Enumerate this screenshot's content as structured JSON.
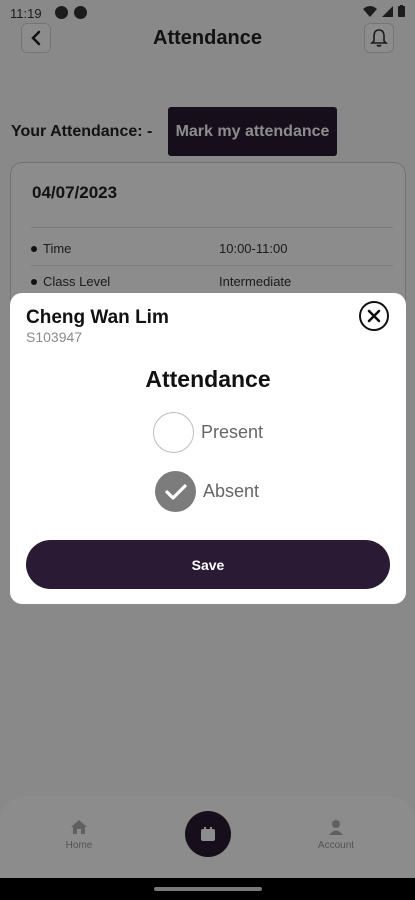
{
  "status_bar": {
    "time": "11:19"
  },
  "header": {
    "title": "Attendance"
  },
  "your_attendance": {
    "label": "Your Attendance: -",
    "button_label": "Mark my attendance"
  },
  "class_card": {
    "date": "04/07/2023",
    "rows": [
      {
        "label": "Time",
        "value": "10:00-11:00"
      },
      {
        "label": "Class Level",
        "value": "Intermediate"
      }
    ]
  },
  "modal": {
    "student_name": "Cheng Wan Lim",
    "student_id": "S103947",
    "title": "Attendance",
    "options": [
      {
        "label": "Present",
        "selected": false
      },
      {
        "label": "Absent",
        "selected": true
      }
    ],
    "save_label": "Save"
  },
  "bottom_nav": {
    "items": [
      {
        "label": "Home",
        "icon": "home-icon"
      },
      {
        "label": "",
        "icon": "calendar-icon"
      },
      {
        "label": "Account",
        "icon": "person-icon"
      }
    ]
  },
  "colors": {
    "primary": "#2a1a34",
    "checked": "#7c7c7c"
  }
}
